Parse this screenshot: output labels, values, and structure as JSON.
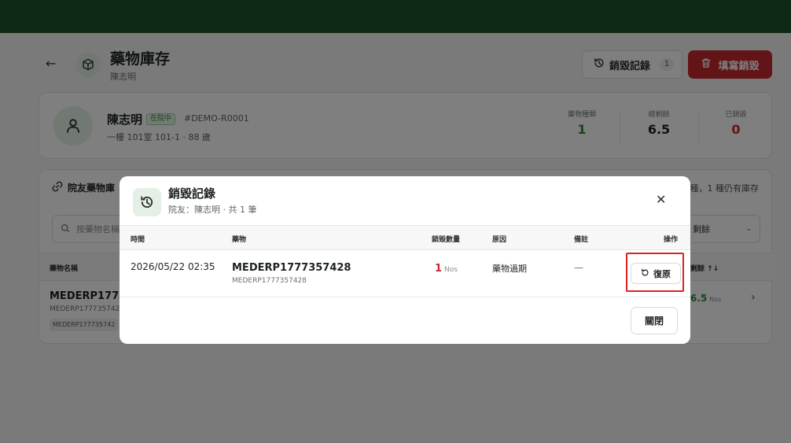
{
  "header": {
    "back_icon": "arrow-left-icon",
    "page_icon": "cube-icon",
    "title": "藥物庫存",
    "subtitle": "陳志明",
    "history_button": {
      "label": "銷毀記錄",
      "count": "1",
      "icon": "history-icon"
    },
    "destroy_button": {
      "label": "填寫銷毀",
      "icon": "trash-icon"
    }
  },
  "patient": {
    "name": "陳志明",
    "status": "在院中",
    "code": "#DEMO-R0001",
    "room_age": "一樓 101室 101-1 · 88 歲",
    "stats": [
      {
        "label": "藥物種類",
        "value": "1",
        "color": "#2a8a3a"
      },
      {
        "label": "總剩餘",
        "value": "6.5",
        "color": "#1d2322"
      },
      {
        "label": "已銷毀",
        "value": "0",
        "color": "#c5282c"
      }
    ]
  },
  "stock": {
    "title": "院友藥物庫",
    "right_note": "種，1 種仍有庫存",
    "search_placeholder": "按藥物名稱",
    "select_value": "剩餘",
    "col_name": "藥物名稱",
    "col_remaining": "剩餘 ↑↓",
    "row": {
      "name": "MEDERP17773",
      "code": "MEDERP177735742",
      "tag": "MEDERP177735742",
      "remaining": "6.5",
      "unit": "Nos"
    }
  },
  "modal": {
    "title": "銷毀記錄",
    "subtitle": "院友：陳志明 · 共 1 筆",
    "icon": "history-icon",
    "close_icon": "close-icon",
    "columns": {
      "time": "時間",
      "medicine": "藥物",
      "qty": "銷毀數量",
      "reason": "原因",
      "note": "備註",
      "action": "操作"
    },
    "rows": [
      {
        "time": "2026/05/22 02:35",
        "medicine": "MEDERP1777357428",
        "code": "MEDERP1777357428",
        "qty": "1",
        "unit": "Nos",
        "reason": "藥物過期",
        "note": "—",
        "action_label": "復原"
      }
    ],
    "close_button": "關閉"
  },
  "colors": {
    "topbar": "#1d5528",
    "accent_green": "#2a8a3a",
    "danger": "#c5282c",
    "highlight": "#e02020"
  }
}
